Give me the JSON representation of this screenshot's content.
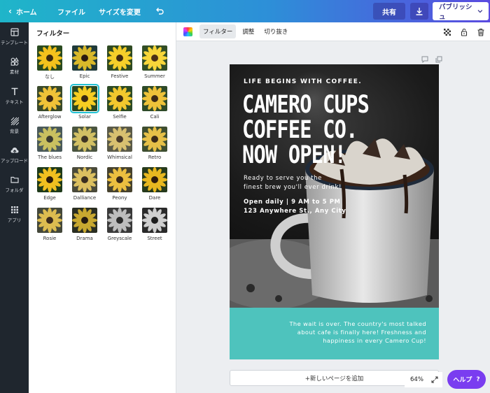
{
  "topbar": {
    "home": "ホーム",
    "file": "ファイル",
    "resize": "サイズを変更",
    "share": "共有",
    "publish": "パブリッシュ"
  },
  "sidebar": {
    "items": [
      {
        "label": "テンプレート",
        "icon": "template-icon"
      },
      {
        "label": "素材",
        "icon": "elements-icon"
      },
      {
        "label": "テキスト",
        "icon": "text-icon"
      },
      {
        "label": "背景",
        "icon": "background-icon"
      },
      {
        "label": "アップロード",
        "icon": "upload-icon"
      },
      {
        "label": "フォルダ",
        "icon": "folder-icon"
      },
      {
        "label": "アプリ",
        "icon": "apps-icon"
      }
    ]
  },
  "panel": {
    "title": "フィルター",
    "filters": [
      {
        "name": "なし",
        "tone": "none"
      },
      {
        "name": "Epic",
        "tone": "epic"
      },
      {
        "name": "Festive",
        "tone": "festive"
      },
      {
        "name": "Summer",
        "tone": "summer"
      },
      {
        "name": "Afterglow",
        "tone": "afterglow"
      },
      {
        "name": "Solar",
        "tone": "solar",
        "selected": true
      },
      {
        "name": "Selfie",
        "tone": "selfie"
      },
      {
        "name": "Cali",
        "tone": "cali"
      },
      {
        "name": "The blues",
        "tone": "blues"
      },
      {
        "name": "Nordic",
        "tone": "nordic"
      },
      {
        "name": "Whimsical",
        "tone": "whimsical"
      },
      {
        "name": "Retro",
        "tone": "retro"
      },
      {
        "name": "Edge",
        "tone": "edge"
      },
      {
        "name": "Dalliance",
        "tone": "dalliance"
      },
      {
        "name": "Peony",
        "tone": "peony"
      },
      {
        "name": "Dare",
        "tone": "dare"
      },
      {
        "name": "Rosie",
        "tone": "rosie"
      },
      {
        "name": "Drama",
        "tone": "drama"
      },
      {
        "name": "Greyscale",
        "tone": "greyscale"
      },
      {
        "name": "Street",
        "tone": "street"
      }
    ]
  },
  "toolbar": {
    "filter": "フィルター",
    "adjust": "調整",
    "crop": "切り抜き"
  },
  "poster": {
    "tagline": "LIFE BEGINS WITH COFFEE.",
    "headline_1": "CAMERO CUPS",
    "headline_2": "COFFEE CO.",
    "headline_3": "NOW OPEN!",
    "ready_1": "Ready to serve you the",
    "ready_2": "finest brew you'll ever drink!",
    "open_1": "Open daily | 9 AM to 5 PM",
    "open_2": "123 Anywhere St., Any City",
    "wait_1": "The wait is over. The country's most talked",
    "wait_2": "about cafe is finally here! Freshness and",
    "wait_3": "happiness in every Camero Cup!",
    "teal_color": "#4ec3bd"
  },
  "canvas": {
    "add_page": "+新しいページを追加",
    "zoom": "64%",
    "help": "ヘルプ",
    "help_q": "?"
  }
}
